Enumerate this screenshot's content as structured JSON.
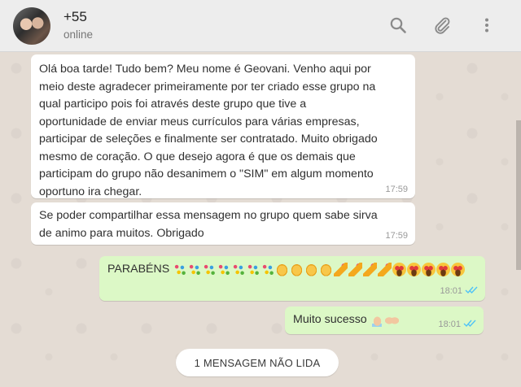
{
  "header": {
    "contact_name": "+55",
    "status": "online",
    "icons": [
      "search-icon",
      "attach-icon",
      "more-vertical-icon"
    ]
  },
  "messages": [
    {
      "direction": "in",
      "text": "Olá boa tarde! Tudo bem? Meu nome é Geovani. Venho aqui por\nmeio deste agradecer primeiramente por ter criado esse grupo na\nqual participo pois foi  através deste grupo que tive a\noportunidade de enviar meus currículos para várias empresas,\nparticipar de seleções e finalmente ser contratado. Muito obrigado\nmesmo de coração. O que desejo agora é que os demais que\nparticipam do grupo não desanimem o \"SIM\" em algum momento\noportuno ira chegar.",
      "time": "17:59"
    },
    {
      "direction": "in",
      "text": "Se poder compartilhar essa mensagem no grupo quem sabe sirva\nde animo para muitos. Obrigado",
      "time": "17:59"
    },
    {
      "direction": "out",
      "text": "PARABÉNS",
      "emojis": [
        "confetti",
        "confetti",
        "confetti",
        "confetti",
        "confetti",
        "confetti",
        "confetti",
        "clap",
        "clap",
        "clap",
        "clap",
        "popper",
        "popper",
        "popper",
        "popper",
        "starface",
        "starface",
        "starface",
        "starface",
        "starface"
      ],
      "time": "18:01",
      "status": "read"
    },
    {
      "direction": "out",
      "text": "Muito sucesso",
      "emojis": [
        "pray",
        "openhands"
      ],
      "time": "18:01",
      "status": "read"
    }
  ],
  "unread_banner": "1 MENSAGEM NÃO LIDA",
  "colors": {
    "header_bg": "#ededed",
    "chat_bg": "#e4dcd4",
    "incoming_bubble": "#ffffff",
    "outgoing_bubble": "#dcf8c6",
    "read_ticks": "#4fc3f7"
  }
}
